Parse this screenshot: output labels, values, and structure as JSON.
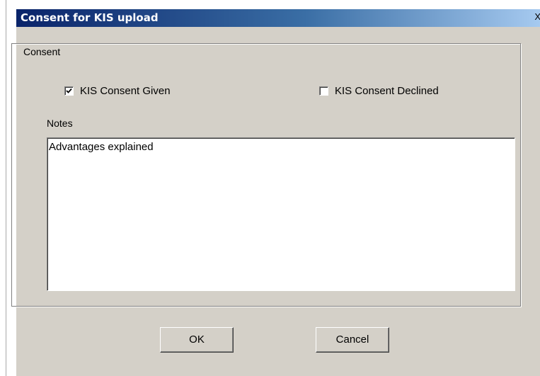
{
  "window": {
    "title": "Consent for KIS upload",
    "close_label": "X"
  },
  "consent_group": {
    "label": "Consent",
    "given": {
      "label": "KIS Consent Given",
      "checked": true
    },
    "declined": {
      "label": "KIS Consent Declined",
      "checked": false
    },
    "notes_label": "Notes",
    "notes_value": "Advantages explained"
  },
  "buttons": {
    "ok": "OK",
    "cancel": "Cancel"
  },
  "icons": {
    "check": "check-mark-icon",
    "close": "close-icon"
  }
}
